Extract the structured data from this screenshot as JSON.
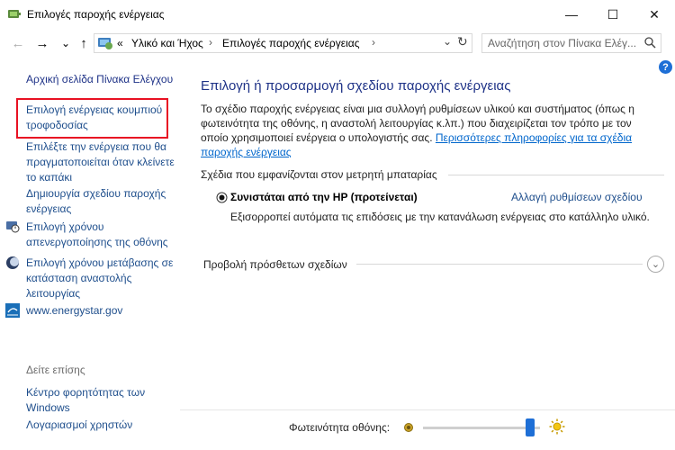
{
  "window": {
    "title": "Επιλογές παροχής ενέργειας",
    "minimize": "—",
    "maximize": "☐",
    "close": "✕"
  },
  "nav": {
    "back": "←",
    "forward": "→",
    "dropdown": "⌄",
    "up": "↑",
    "breadcrumb_overflow": "«",
    "crumb_1": "Υλικό και Ήχος",
    "crumb_2": "Επιλογές παροχής ενέργειας",
    "sep_1": "›",
    "sep_2": "›",
    "address_dropdown": "⌄",
    "refresh": "↻",
    "search_placeholder": "Αναζήτηση στον Πίνακα Ελέγ..."
  },
  "sidebar": {
    "home": "Αρχική σελίδα Πίνακα Ελέγχου",
    "items": [
      "Επιλογή ενέργειας κουμπιού τροφοδοσίας",
      "Επιλέξτε την ενέργεια που θα πραγματοποιείται όταν κλείνετε το καπάκι",
      "Δημιουργία σχεδίου παροχής ενέργειας",
      "Επιλογή χρόνου απενεργοποίησης της οθόνης",
      "Επιλογή χρόνου μετάβασης σε κατάσταση αναστολής λειτουργίας",
      "www.energystar.gov"
    ],
    "see_also": "Δείτε επίσης",
    "see_also_items": [
      "Κέντρο φορητότητας των Windows",
      "Λογαριασμοί χρηστών"
    ]
  },
  "main": {
    "title": "Επιλογή ή προσαρμογή σχεδίου παροχής ενέργειας",
    "description": "Το σχέδιο παροχής ενέργειας είναι μια συλλογή ρυθμίσεων υλικού και συστήματος (όπως η φωτεινότητα της οθόνης, η αναστολή λειτουργίας κ.λπ.) που διαχειρίζεται τον τρόπο με τον οποίο χρησιμοποιεί ενέργεια ο υπολογιστής σας. ",
    "more_info_link": "Περισσότερες πληροφορίες για τα σχέδια παροχής ενέργειας",
    "section_heading": "Σχέδια που εμφανίζονται στον μετρητή μπαταρίας",
    "plan_name": "Συνιστάται από την HP (προτείνεται)",
    "plan_change_link": "Αλλαγή ρυθμίσεων σχεδίου",
    "plan_description": "Εξισορροπεί αυτόματα τις επιδόσεις με την κατανάλωση ενέργειας στο κατάλληλο υλικό.",
    "more_plans": "Προβολή πρόσθετων σχεδίων",
    "help": "?"
  },
  "footer": {
    "brightness_label": "Φωτεινότητα οθόνης:",
    "brightness_level": 0.95
  },
  "colors": {
    "link": "#1e4e8c",
    "title": "#1e3287",
    "highlight_border": "#e81123",
    "slider_thumb": "#1e6fd6"
  }
}
